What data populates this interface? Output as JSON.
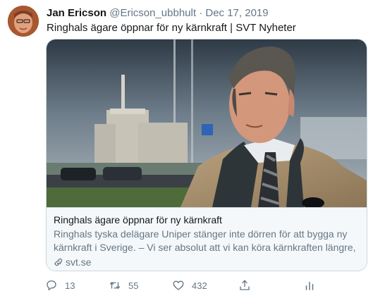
{
  "tweet": {
    "author_name": "Jan Ericson",
    "handle": "@Ericson_ubbhult",
    "separator": "·",
    "date": "Dec 17, 2019",
    "text": "Ringhals ägare öppnar för ny kärnkraft | SVT Nyheter"
  },
  "card": {
    "title": "Ringhals ägare öppnar för ny kärnkraft",
    "description": "Ringhals tyska delägare Uniper stänger inte dörren för att bygga ny kärnkraft i Sverige. – Vi ser absolut att vi kan köra kärnkraften längre, ...",
    "domain": "svt.se"
  },
  "actions": {
    "reply_count": "13",
    "retweet_count": "55",
    "like_count": "432"
  },
  "icons": {
    "reply": "reply-icon",
    "retweet": "retweet-icon",
    "like": "heart-icon",
    "share": "share-icon",
    "analytics": "analytics-icon",
    "link": "link-icon"
  },
  "colors": {
    "secondary_text": "#657786",
    "border": "#ccd6dd",
    "card_footer_bg": "#f5f8fa"
  }
}
